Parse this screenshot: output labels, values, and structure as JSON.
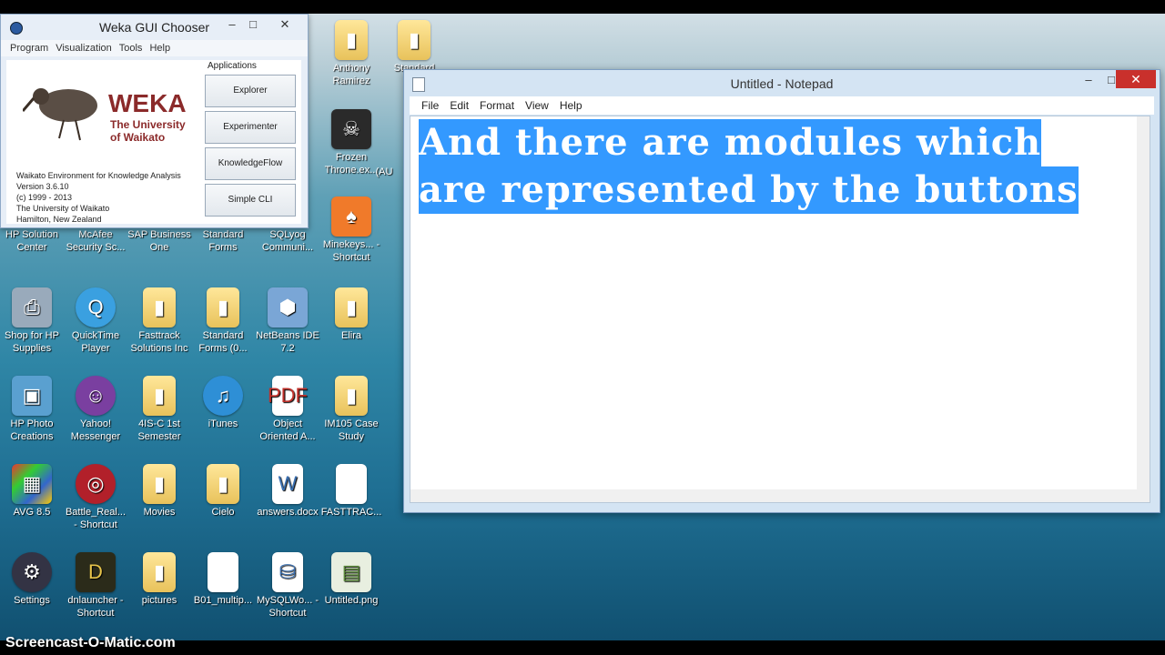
{
  "weka": {
    "title": "Weka GUI Chooser",
    "menu": [
      "Program",
      "Visualization",
      "Tools",
      "Help"
    ],
    "logo_title": "WEKA",
    "logo_sub_1": "The University",
    "logo_sub_2": "of Waikato",
    "info_lines": [
      "Waikato Environment for Knowledge Analysis",
      "Version 3.6.10",
      "(c) 1999 - 2013",
      "The University of Waikato",
      "Hamilton, New Zealand"
    ],
    "applications_label": "Applications",
    "buttons": [
      "Explorer",
      "Experimenter",
      "KnowledgeFlow",
      "Simple CLI"
    ]
  },
  "notepad": {
    "title": "Untitled - Notepad",
    "menu": [
      "File",
      "Edit",
      "Format",
      "View",
      "Help"
    ],
    "line1": "And there are modules which",
    "line2": "are represented by the buttons"
  },
  "desktop": {
    "icons": [
      {
        "label": "Anthony Ramirez",
        "icon": "folder-icon"
      },
      {
        "label": "Standard",
        "icon": "folder-icon"
      },
      {
        "label": "Frozen Throne.ex...",
        "icon": "game-icon"
      },
      {
        "label": "(AU",
        "icon": "app-icon"
      },
      {
        "label": "HP Solution Center",
        "icon": "hp-icon"
      },
      {
        "label": "McAfee Security Sc...",
        "icon": "shield-icon"
      },
      {
        "label": "SAP Business One",
        "icon": "app-icon"
      },
      {
        "label": "Standard Forms",
        "icon": "folder-icon"
      },
      {
        "label": "SQLyog Communi...",
        "icon": "database-icon"
      },
      {
        "label": "Minekeys... - Shortcut",
        "icon": "shortcut-icon"
      },
      {
        "label": "Shop for HP Supplies",
        "icon": "printer-icon"
      },
      {
        "label": "QuickTime Player",
        "icon": "quicktime-icon"
      },
      {
        "label": "Fasttrack Solutions Inc",
        "icon": "folder-icon"
      },
      {
        "label": "Standard Forms (0...",
        "icon": "folder-icon"
      },
      {
        "label": "NetBeans IDE 7.2",
        "icon": "cube-icon"
      },
      {
        "label": "Elira",
        "icon": "folder-icon"
      },
      {
        "label": "HP Photo Creations",
        "icon": "photo-icon"
      },
      {
        "label": "Yahoo! Messenger",
        "icon": "smiley-icon"
      },
      {
        "label": "4IS-C 1st Semester",
        "icon": "folder-icon"
      },
      {
        "label": "iTunes",
        "icon": "music-icon"
      },
      {
        "label": "Object Oriented A...",
        "icon": "pdf-icon"
      },
      {
        "label": "IM105 Case Study",
        "icon": "folder-icon"
      },
      {
        "label": "AVG 8.5",
        "icon": "avg-icon"
      },
      {
        "label": "Battle_Real... - Shortcut",
        "icon": "game-icon"
      },
      {
        "label": "Movies",
        "icon": "folder-icon"
      },
      {
        "label": "Cielo",
        "icon": "folder-icon"
      },
      {
        "label": "answers.docx",
        "icon": "document-icon"
      },
      {
        "label": "FASTTRAC...",
        "icon": "file-icon"
      },
      {
        "label": "Settings",
        "icon": "settings-icon"
      },
      {
        "label": "dnlauncher - Shortcut",
        "icon": "launcher-icon"
      },
      {
        "label": "pictures",
        "icon": "folder-icon"
      },
      {
        "label": "B01_multip...",
        "icon": "file-icon"
      },
      {
        "label": "MySQLWo... - Shortcut",
        "icon": "database-icon"
      },
      {
        "label": "Untitled.png",
        "icon": "image-icon"
      }
    ]
  },
  "watermark": "Screencast-O-Matic.com"
}
